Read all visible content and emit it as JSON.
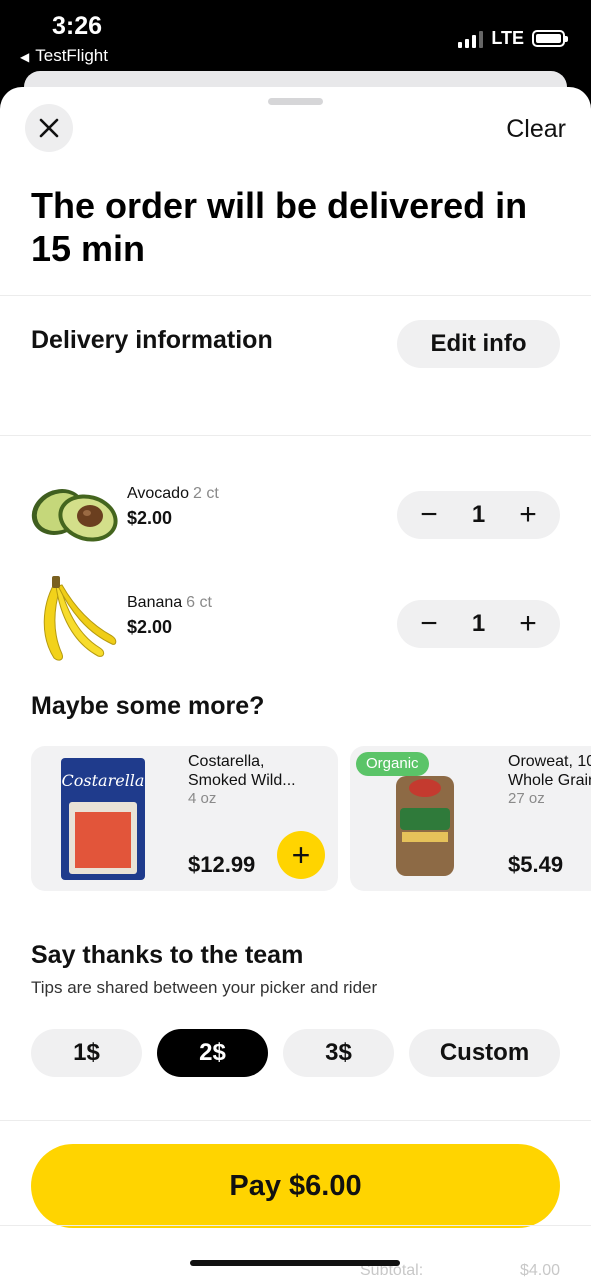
{
  "status_bar": {
    "time": "3:26",
    "back_app": "TestFlight",
    "network": "LTE"
  },
  "header": {
    "close_icon": "close-icon",
    "clear_label": "Clear",
    "title": "The order will be delivered in 15 min"
  },
  "delivery": {
    "label": "Delivery information",
    "edit_label": "Edit info"
  },
  "cart": {
    "items": [
      {
        "name": "Avocado",
        "qty": "2 ct",
        "price": "$2.00",
        "count": "1",
        "minus": "−",
        "plus": "+"
      },
      {
        "name": "Banana",
        "qty": "6 ct",
        "price": "$2.00",
        "count": "1",
        "minus": "−",
        "plus": "+"
      }
    ]
  },
  "upsell": {
    "heading": "Maybe some more?",
    "products": [
      {
        "name_line1": "Costarella,",
        "name_line2": "Smoked Wild...",
        "size": "4 oz",
        "price": "$12.99",
        "add": "+"
      },
      {
        "badge": "Organic",
        "name_line1": "Oroweat, 10",
        "name_line2": "Whole Grain",
        "size": "27 oz",
        "price": "$5.49"
      }
    ]
  },
  "tips": {
    "heading": "Say thanks to the team",
    "subtitle": "Tips are shared between your picker and rider",
    "options": [
      "1$",
      "2$",
      "3$",
      "Custom"
    ],
    "selected": "2$"
  },
  "pay": {
    "label": "Pay $6.00"
  },
  "summary": {
    "subtotal_label": "Subtotal:",
    "subtotal_value": "$4.00"
  },
  "colors": {
    "accent": "#ffd400",
    "organic": "#5bc468",
    "selected_tip": "#000000"
  }
}
